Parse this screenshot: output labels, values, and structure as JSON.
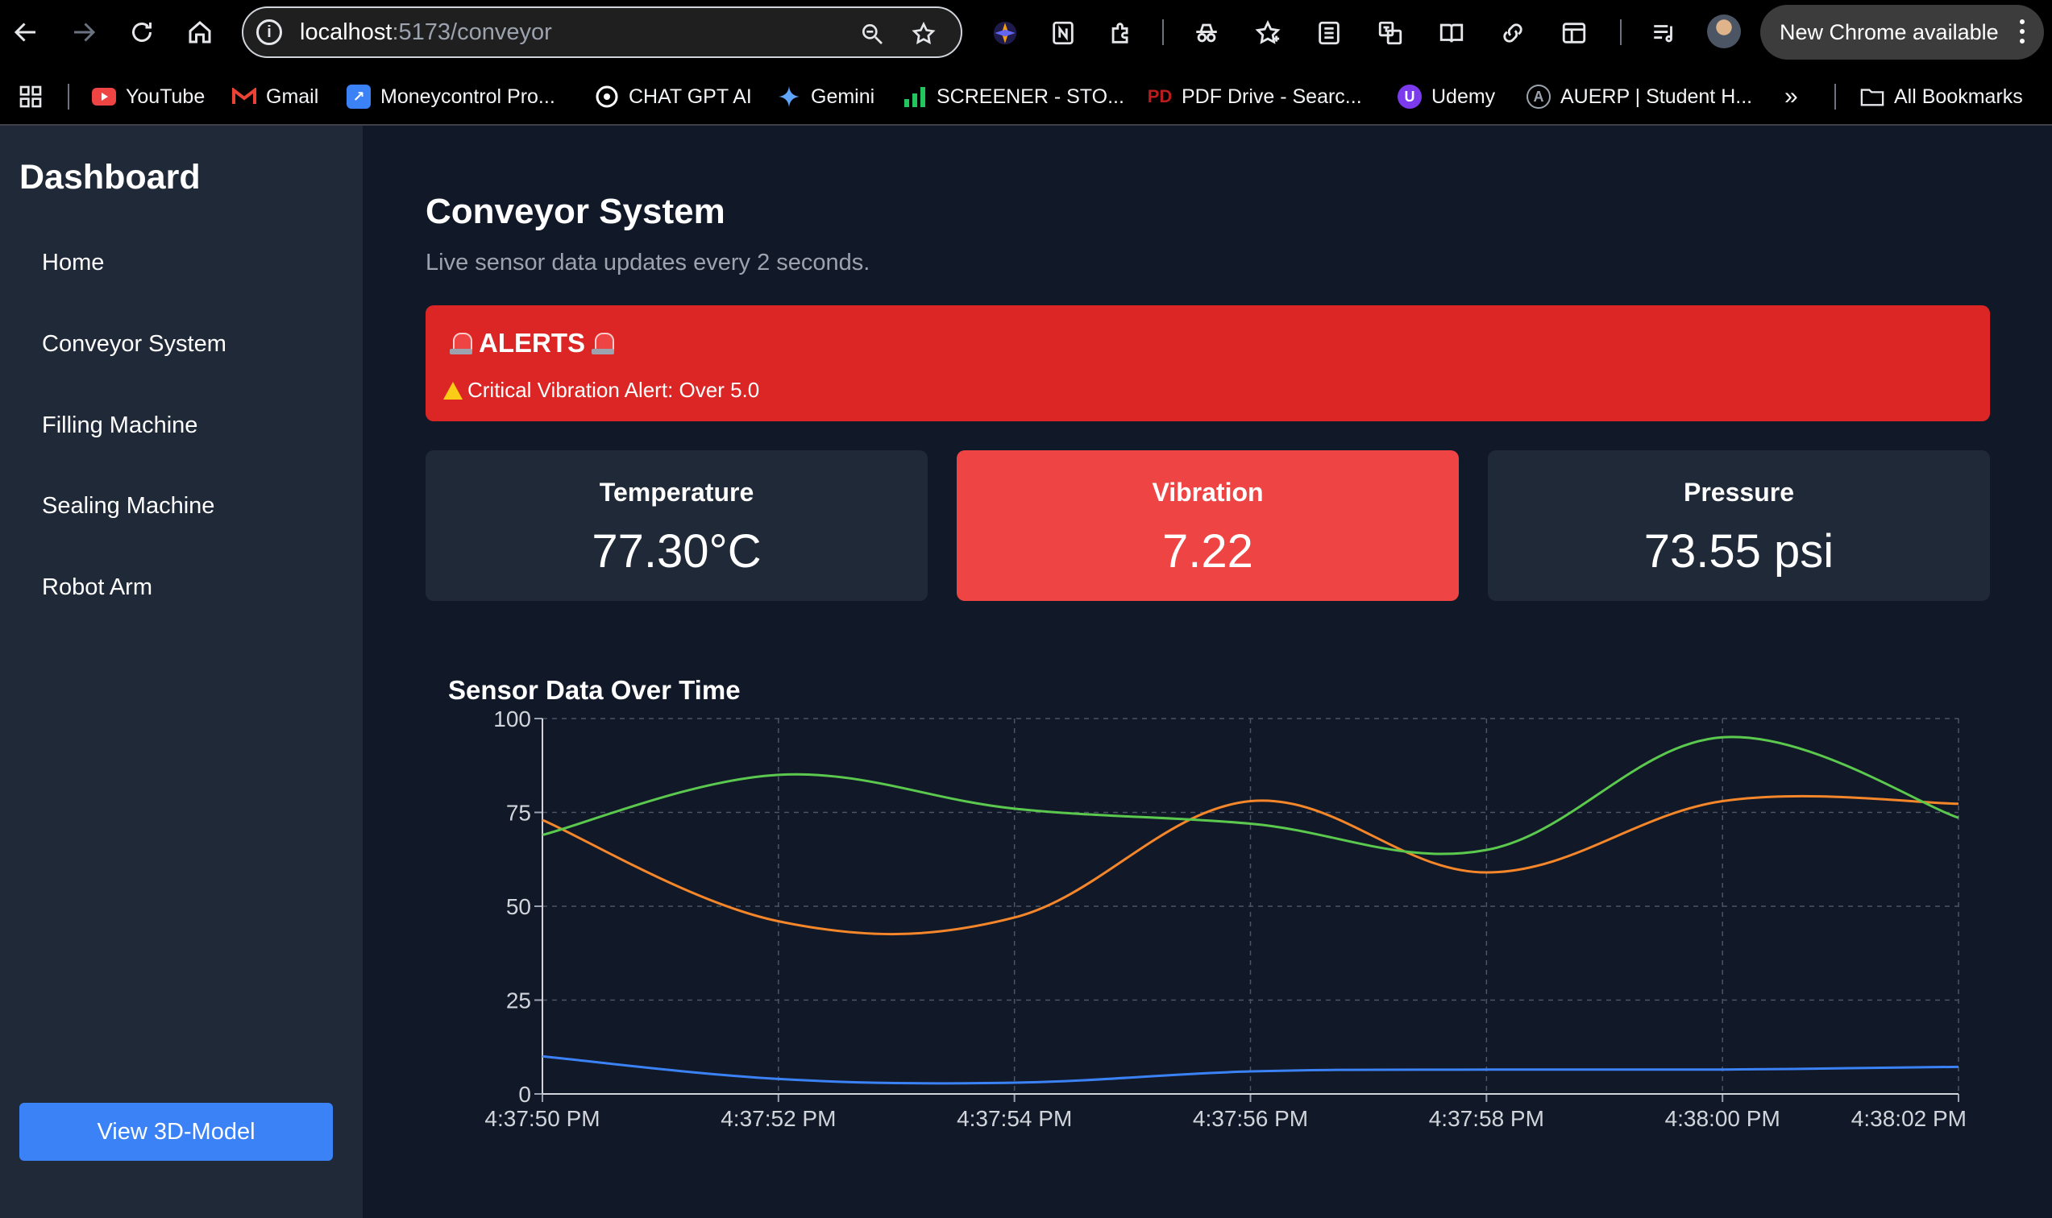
{
  "browser": {
    "url_host": "localhost",
    "url_path": ":5173/conveyor",
    "update_label": "New Chrome available",
    "bookmarks": [
      {
        "label": "YouTube",
        "icon": "youtube-icon",
        "color": "#ef4444"
      },
      {
        "label": "Gmail",
        "icon": "gmail-icon",
        "color": "#ea4335"
      },
      {
        "label": "Moneycontrol Pro...",
        "icon": "moneycontrol-icon",
        "color": "#3b82f6"
      },
      {
        "label": "CHAT GPT AI",
        "icon": "openai-icon",
        "color": "#ffffff"
      },
      {
        "label": "Gemini",
        "icon": "gemini-icon",
        "color": "#60a5fa"
      },
      {
        "label": "SCREENER - STO...",
        "icon": "screener-icon",
        "color": "#22c55e"
      },
      {
        "label": "PDF Drive - Searc...",
        "icon": "pdfdrive-icon",
        "color": "#b91c1c"
      },
      {
        "label": "Udemy",
        "icon": "udemy-icon",
        "color": "#7c3aed"
      },
      {
        "label": "AUERP | Student H...",
        "icon": "auerp-icon",
        "color": "#9ca3af"
      },
      {
        "label": "All Bookmarks",
        "icon": "folder-icon",
        "color": "#e5e7eb"
      }
    ]
  },
  "sidebar": {
    "title": "Dashboard",
    "items": [
      {
        "label": "Home"
      },
      {
        "label": "Conveyor System"
      },
      {
        "label": "Filling Machine"
      },
      {
        "label": "Sealing Machine"
      },
      {
        "label": "Robot Arm"
      }
    ],
    "button_label": "View 3D-Model"
  },
  "main": {
    "title": "Conveyor System",
    "subtitle": "Live sensor data updates every 2 seconds.",
    "alert": {
      "title": "ALERTS",
      "message": "Critical Vibration Alert: Over 5.0"
    },
    "cards": [
      {
        "label": "Temperature",
        "value": "77.30°C"
      },
      {
        "label": "Vibration",
        "value": "7.22"
      },
      {
        "label": "Pressure",
        "value": "73.55 psi"
      }
    ]
  },
  "chart_data": {
    "type": "line",
    "title": "Sensor Data Over Time",
    "x": [
      "4:37:50 PM",
      "4:37:52 PM",
      "4:37:54 PM",
      "4:37:56 PM",
      "4:37:58 PM",
      "4:38:00 PM",
      "4:38:02 PM"
    ],
    "ylim": [
      0,
      100
    ],
    "yticks": [
      0,
      25,
      50,
      75,
      100
    ],
    "grid": true,
    "series": [
      {
        "color": "#f5862a",
        "values": [
          73,
          46,
          47,
          78,
          59,
          78,
          77.3
        ]
      },
      {
        "color": "#5bc94e",
        "values": [
          69,
          85,
          76,
          72,
          65,
          95,
          73.55
        ]
      },
      {
        "color": "#3b82f6",
        "values": [
          10,
          4,
          3,
          6,
          6.5,
          6.5,
          7.22
        ]
      }
    ]
  },
  "colors": {
    "background": "#111827",
    "panel": "#1f2937",
    "alert": "#dc2626",
    "highlight_card": "#ef4444",
    "button": "#3b82f6"
  }
}
